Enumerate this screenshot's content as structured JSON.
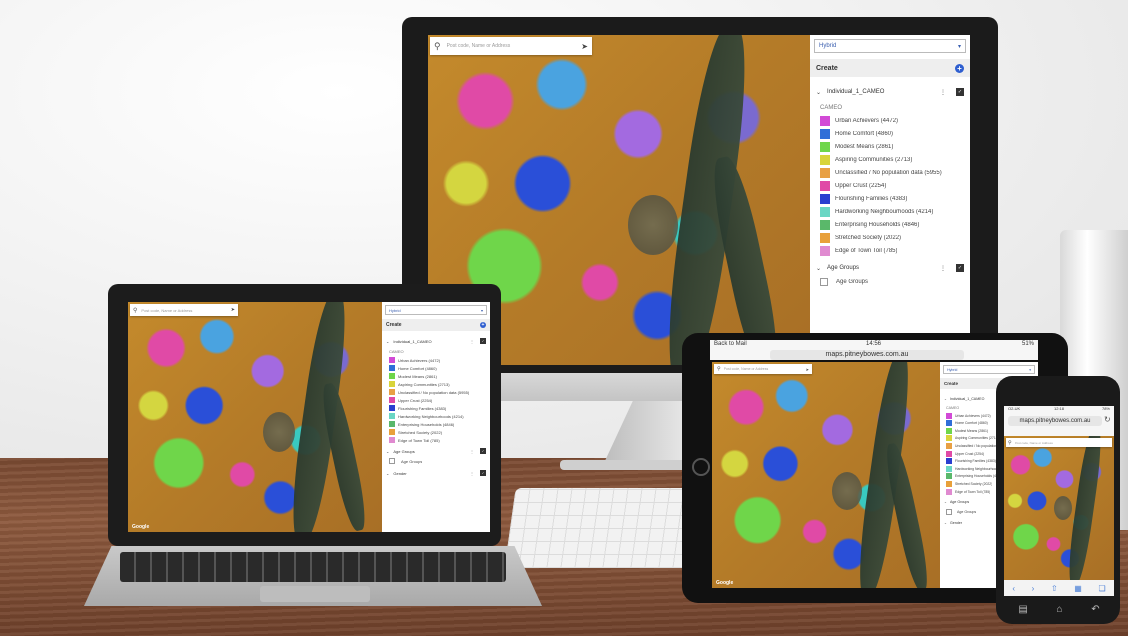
{
  "search": {
    "placeholder": "Post code, Name or Address"
  },
  "panel": {
    "basemap": "Hybrid",
    "create_label": "Create",
    "layers": [
      {
        "name": "Individual_1_CAMEO",
        "subtitle": "CAMEO",
        "legend": [
          {
            "label": "Urban Achievers (4472)",
            "color": "#d24ad6"
          },
          {
            "label": "Home Comfort (4860)",
            "color": "#2f6ed8"
          },
          {
            "label": "Modest Means (2861)",
            "color": "#6fd64a"
          },
          {
            "label": "Aspiring Communities (2713)",
            "color": "#d8d43a"
          },
          {
            "label": "Unclassified / No population data (5955)",
            "color": "#e8a044"
          },
          {
            "label": "Upper Crust (2254)",
            "color": "#e04aa6"
          },
          {
            "label": "Flourishing Families (4383)",
            "color": "#2a3fd0"
          },
          {
            "label": "Hardworking Neighbourhoods (4214)",
            "color": "#6ad6c4"
          },
          {
            "label": "Enterprising Households (4846)",
            "color": "#5ab86a"
          },
          {
            "label": "Stretched Society (2022)",
            "color": "#e8a03a"
          },
          {
            "label": "Edge of Town Toil (785)",
            "color": "#e08ad0"
          }
        ]
      },
      {
        "name": "Age Groups",
        "subtitle": "Age Groups"
      },
      {
        "name": "Gender"
      }
    ]
  },
  "tablet": {
    "back_label": "Back to Mail",
    "time": "14:56",
    "battery": "51%",
    "url": "maps.pitneybowes.com.au"
  },
  "phone": {
    "carrier": "O2-UK",
    "time": "12:18",
    "battery": "78%",
    "url": "maps.pitneybowes.com.au"
  },
  "map": {
    "attribution": "Google"
  }
}
